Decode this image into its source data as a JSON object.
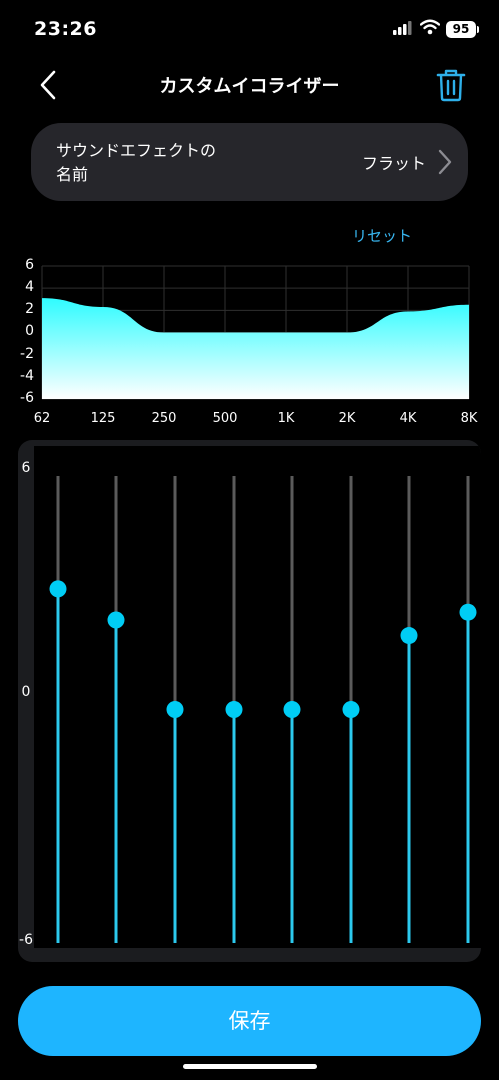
{
  "status_bar": {
    "time": "23:26",
    "battery": "95"
  },
  "nav": {
    "title": "カスタムイコライザー"
  },
  "sound_effect": {
    "label": "サウンドエフェクトの名前",
    "value": "フラット"
  },
  "reset_label": "リセット",
  "curve": {
    "y_ticks": [
      "6",
      "4",
      "2",
      "0",
      "-2",
      "-4",
      "-6"
    ],
    "x_labels": [
      "62",
      "125",
      "250",
      "500",
      "1K",
      "2K",
      "4K",
      "8K"
    ]
  },
  "equalizer": {
    "scale_labels": [
      "6",
      "0",
      "-6"
    ],
    "bands": [
      "62",
      "125",
      "250",
      "500",
      "1K",
      "2K",
      "4K",
      "8K"
    ],
    "gains_db": [
      3.1,
      2.3,
      0.0,
      0.0,
      0.0,
      0.0,
      1.9,
      2.5
    ],
    "range_db": [
      -6,
      6
    ]
  },
  "colors": {
    "accent": "#1eb5ff",
    "curve_fill_top": "#2ffcff",
    "slider_track": "#2cc9ee"
  },
  "icons": {
    "back": "chevron-left-icon",
    "trash": "trash-icon",
    "chevron": "chevron-right-icon"
  },
  "save_label": "保存"
}
